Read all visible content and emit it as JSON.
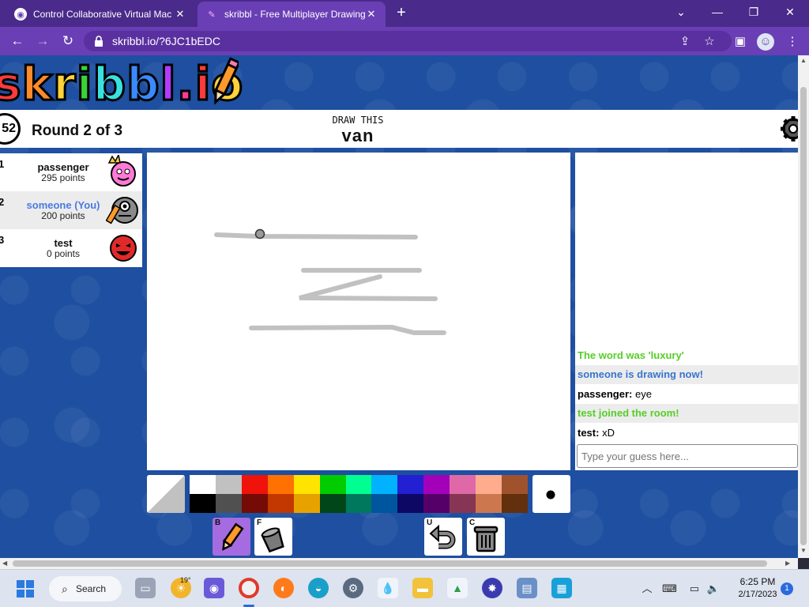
{
  "browser": {
    "tabs": [
      {
        "title": "Control Collaborative Virtual Mac",
        "close": "✕"
      },
      {
        "title": "skribbl - Free Multiplayer Drawing",
        "close": "✕"
      }
    ],
    "new_tab": "+",
    "url": "skribbl.io/?6JC1bEDC",
    "window_controls": {
      "minimize": "—",
      "restore": "❐",
      "close": "✕",
      "tab_search": "⌄"
    }
  },
  "game": {
    "logo_letters": [
      "s",
      "k",
      "r",
      "i",
      "b",
      "b",
      "l",
      ".",
      "i",
      "o"
    ],
    "logo_colors": [
      "#ff3a3a",
      "#ff8a2a",
      "#ffd23a",
      "#3ad23a",
      "#3ae0e0",
      "#3a8aff",
      "#b43aff",
      "#ff3a9a",
      "#ff3a3a",
      "#ffd23a"
    ],
    "timer": "52",
    "round": "Round 2 of 3",
    "draw_label": "DRAW THIS",
    "word": "van",
    "players": [
      {
        "rank": "1",
        "name": "passenger",
        "points": "295 points",
        "avatar": "pink-avatar-icon"
      },
      {
        "rank": "2",
        "name": "someone (You)",
        "points": "200 points",
        "avatar": "gray-avatar-icon"
      },
      {
        "rank": "3",
        "name": "test",
        "points": "0 points",
        "avatar": "red-avatar-icon"
      }
    ],
    "chat": [
      {
        "author": "",
        "text": "The word was 'luxury'",
        "color": "#56ce27"
      },
      {
        "author": "",
        "text": "someone is drawing now!",
        "color": "#3975ce"
      },
      {
        "author": "passenger:",
        "text": " eye",
        "color": "#000000"
      },
      {
        "author": "",
        "text": "test joined the room!",
        "color": "#56ce27"
      },
      {
        "author": "test:",
        "text": " xD",
        "color": "#000000"
      }
    ],
    "guess_placeholder": "Type your guess here...",
    "palette": [
      "#ffffff",
      "#c1c1c1",
      "#ef130b",
      "#ff7100",
      "#ffe400",
      "#00cc00",
      "#00ff91",
      "#00b2ff",
      "#231fd3",
      "#a300ba",
      "#df69a7",
      "#ffac8e",
      "#a0522d",
      "#000000",
      "#505050",
      "#740b07",
      "#c23800",
      "#e8a200",
      "#004619",
      "#00785d",
      "#00569e",
      "#0e0865",
      "#550069",
      "#873554",
      "#cc774d",
      "#63300d"
    ],
    "tools": [
      {
        "key": "B",
        "name": "brush"
      },
      {
        "key": "F",
        "name": "fill"
      },
      {
        "key": "U",
        "name": "undo"
      },
      {
        "key": "C",
        "name": "clear"
      }
    ]
  },
  "taskbar": {
    "search_label": "Search",
    "weather_temp": "19°",
    "time": "6:25 PM",
    "date": "2/17/2023",
    "notifications": "1"
  }
}
